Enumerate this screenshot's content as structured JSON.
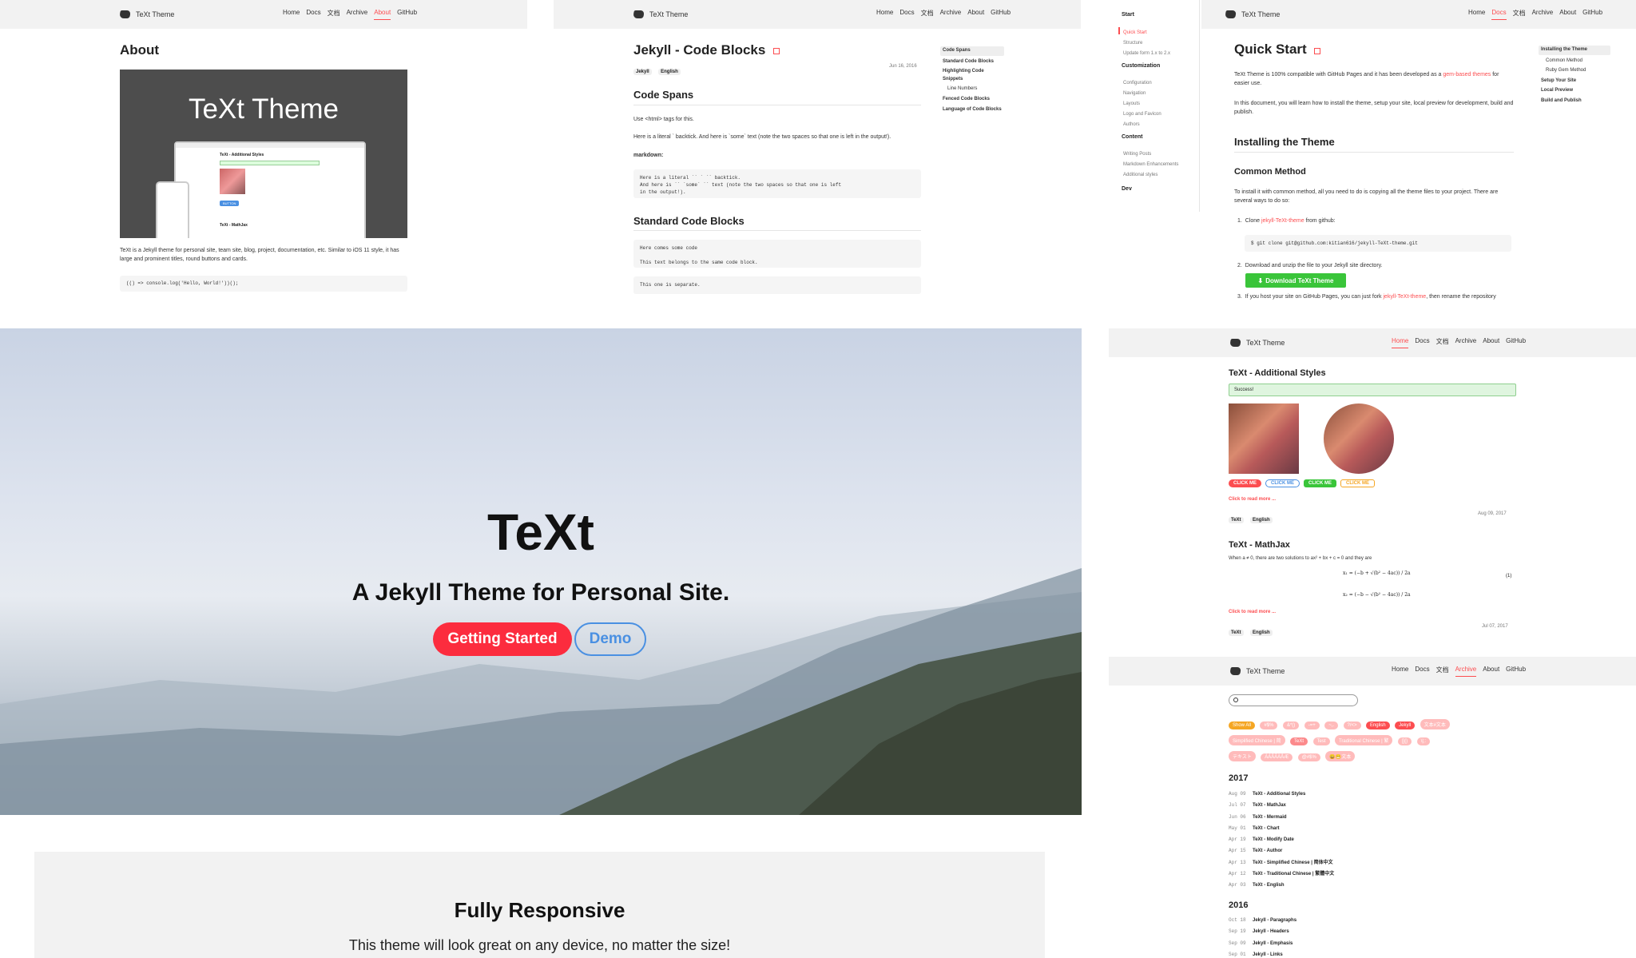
{
  "colors": {
    "accent": "#fc4d50",
    "nav_bg": "#f2f2f2",
    "code_bg": "#f5f5f5",
    "demo_blue": "#4a90e2"
  },
  "nav": {
    "brand": "TeXt Theme",
    "home": "Home",
    "docs": "Docs",
    "docs_cn": "文档",
    "archive": "Archive",
    "about": "About",
    "github": "GitHub"
  },
  "about": {
    "title": "About",
    "banner_title": "TeXt Theme",
    "preview_title": "TeXt - Additional Styles",
    "preview_subtitle": "TeXt - MathJax",
    "preview_button": "BUTTON",
    "text": "TeXt is a Jekyll theme for personal site, team site, blog, project, documentation, etc. Similar to iOS 11 style, it has large and prominent titles, round buttons and cards.",
    "code": "(() => console.log('Hello, World!'))();"
  },
  "codeblocks": {
    "title": "Jekyll - Code Blocks",
    "tags": [
      "Jekyll",
      "English"
    ],
    "date": "Jun 16, 2016",
    "section1": "Code Spans",
    "use_text": "Use <html> tags for this.",
    "literal_text": "Here is a literal ` backtick. And here is `some` text (note the two spaces so that one is left in the output!).",
    "markdown_label": "markdown:",
    "code1": "Here is a literal `` ` `` backtick.\nAnd here is `` `some` `` text (note the two spaces so that one is left\nin the output!).",
    "section2": "Standard Code Blocks",
    "code2": "Here comes some code\n\nThis text belongs to the same code block.",
    "code3": "This one is separate.",
    "toc": [
      "Code Spans",
      "Standard Code Blocks",
      "Highlighting Code Snippets",
      "Line Numbers",
      "Fenced Code Blocks",
      "Language of Code Blocks"
    ]
  },
  "quickstart": {
    "sidebar": {
      "start": "Start",
      "start_items": [
        "Quick Start",
        "Structure",
        "Update form 1.x to 2.x"
      ],
      "custom": "Customization",
      "custom_items": [
        "Configuration",
        "Navigation",
        "Layouts",
        "Logo and Favicon",
        "Authors"
      ],
      "content": "Content",
      "content_items": [
        "Writing Posts",
        "Markdown Enhancements",
        "Additional styles"
      ],
      "dev": "Dev"
    },
    "title": "Quick Start",
    "p1_a": "TeXt Theme is 100% compatible with GitHub Pages and it has been developed as a ",
    "p1_link": "gem-based themes",
    "p1_b": " for easier use.",
    "p2": "In this document, you will learn how to install the theme, setup your site, local preview for development, build and publish.",
    "h_install": "Installing the Theme",
    "h_common": "Common Method",
    "p3": "To install it with common method, all you need to do is copying all the theme files to your project. There are several ways to do so:",
    "step1_a": "Clone ",
    "step1_link": "jekyll-TeXt-theme",
    "step1_b": " from github:",
    "clone_cmd": "$ git clone git@github.com:kitian616/jekyll-TeXt-theme.git",
    "step2": "Download and unzip the file to your Jekyll site directory.",
    "download_btn": "Download TeXt Theme",
    "step3_a": "If you host your site on GitHub Pages, you can just fork ",
    "step3_link": "jekyll-TeXt-theme",
    "step3_b": ", then rename the repository",
    "toc": [
      "Installing the Theme",
      "Common Method",
      "Ruby Gem Method",
      "Setup Your Site",
      "Local Preview",
      "Build and Publish"
    ]
  },
  "hero": {
    "title": "TeXt",
    "subtitle": "A Jekyll Theme for Personal Site.",
    "btn_start": "Getting Started",
    "btn_demo": "Demo"
  },
  "responsive": {
    "title": "Fully Responsive",
    "text": "This theme will look great on any device, no matter the size!"
  },
  "styles": {
    "title": "TeXt - Additional Styles",
    "alert": "Success!",
    "buttons": [
      "CLICK ME",
      "CLICK ME",
      "CLICK ME",
      "CLICK ME"
    ],
    "read_more": "Click to read more ...",
    "tags": [
      "TeXt",
      "English"
    ],
    "date1": "Aug 09, 2017",
    "title2": "TeXt - MathJax",
    "math_text": "When a ≠ 0, there are two solutions to ax² + bx + c = 0 and they are",
    "eq1": "x₁ = (−b + √(b² − 4ac)) / 2a",
    "eq2": "x₂ = (−b − √(b² − 4ac)) / 2a",
    "eq_num": "(1)",
    "read_more2": "Click to read more ...",
    "date2": "Jul 07, 2017"
  },
  "archive": {
    "tags_row1": [
      "Show All",
      "#$%",
      "&*()",
      "-=+",
      "~,.",
      "?/<>",
      "English",
      "Jekyll",
      "文本#文本"
    ],
    "tags_row2": [
      "Simplified Chinese | 简",
      "TeXt",
      "Test",
      "Traditional Chinese | 繁",
      "[]{}",
      "\\|;:"
    ],
    "tags_row3": [
      "テキスト",
      "ÀÁÂÃÄÅÆ",
      "@#$%",
      "😀😁文本"
    ],
    "year1": "2017",
    "posts_2017": [
      [
        "Aug 09",
        "TeXt - Additional Styles"
      ],
      [
        "Jul 07",
        "TeXt - MathJax"
      ],
      [
        "Jun 06",
        "TeXt - Mermaid"
      ],
      [
        "May 01",
        "TeXt - Chart"
      ],
      [
        "Apr 19",
        "TeXt - Modify Date"
      ],
      [
        "Apr 15",
        "TeXt - Author"
      ],
      [
        "Apr 13",
        "TeXt - Simplified Chinese | 简体中文"
      ],
      [
        "Apr 12",
        "TeXt - Traditional Chinese | 繁體中文"
      ],
      [
        "Apr 03",
        "TeXt - English"
      ]
    ],
    "year2": "2016",
    "posts_2016": [
      [
        "Oct 18",
        "Jekyll - Paragraphs"
      ],
      [
        "Sep 19",
        "Jekyll - Headers"
      ],
      [
        "Sep 09",
        "Jekyll - Emphasis"
      ],
      [
        "Sep 01",
        "Jekyll - Links"
      ]
    ]
  }
}
